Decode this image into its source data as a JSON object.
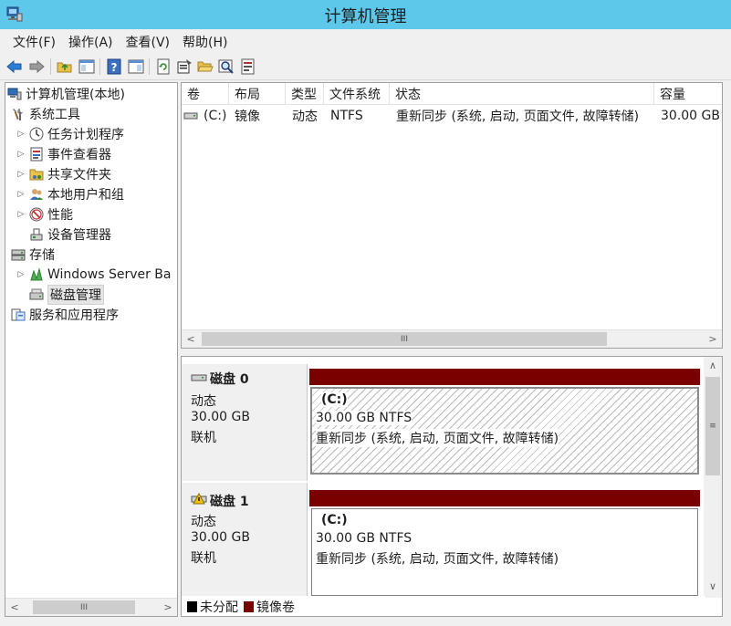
{
  "window": {
    "title": "计算机管理"
  },
  "menu": [
    "文件(F)",
    "操作(A)",
    "查看(V)",
    "帮助(H)"
  ],
  "toolbar": {
    "buttons": [
      "back-icon",
      "forward-icon",
      "up-folder-icon",
      "show-tree-icon",
      "help-icon",
      "action-pane-icon",
      "refresh-icon",
      "properties-icon",
      "open-folder-icon",
      "search-icon",
      "settings-icon"
    ]
  },
  "tree": {
    "root": "计算机管理(本地)",
    "system_tools": "系统工具",
    "task_scheduler": "任务计划程序",
    "event_viewer": "事件查看器",
    "shared_folders": "共享文件夹",
    "local_users": "本地用户和组",
    "performance": "性能",
    "device_manager": "设备管理器",
    "storage": "存储",
    "windows_server_backup": "Windows Server Ba",
    "disk_management": "磁盘管理",
    "services_apps": "服务和应用程序"
  },
  "volume_list": {
    "columns": [
      "卷",
      "布局",
      "类型",
      "文件系统",
      "状态",
      "容量"
    ],
    "rows": [
      [
        "(C:)",
        "镜像",
        "动态",
        "NTFS",
        "重新同步 (系统, 启动, 页面文件, 故障转储)",
        "30.00 GB"
      ]
    ]
  },
  "scroll": {
    "thumb_grip": "III",
    "left_arrow": "<",
    "right_arrow": ">",
    "up_arrow": "∧",
    "down_arrow": "∨",
    "vgrip": "≡"
  },
  "disks": [
    {
      "name": "磁盘 0",
      "type": "动态",
      "size": "30.00 GB",
      "status": "联机",
      "volume": {
        "label": "(C:)",
        "size_fs": "30.00 GB NTFS",
        "state": "重新同步 (系统, 启动, 页面文件, 故障转储)"
      }
    },
    {
      "name": "磁盘 1",
      "type": "动态",
      "size": "30.00 GB",
      "status": "联机",
      "volume": {
        "label": "(C:)",
        "size_fs": "30.00 GB NTFS",
        "state": "重新同步 (系统, 启动, 页面文件, 故障转储)"
      }
    }
  ],
  "legend": {
    "unallocated": "未分配",
    "mirrored": "镜像卷",
    "colors": {
      "unallocated": "#000000",
      "mirrored": "#7a0000"
    }
  }
}
